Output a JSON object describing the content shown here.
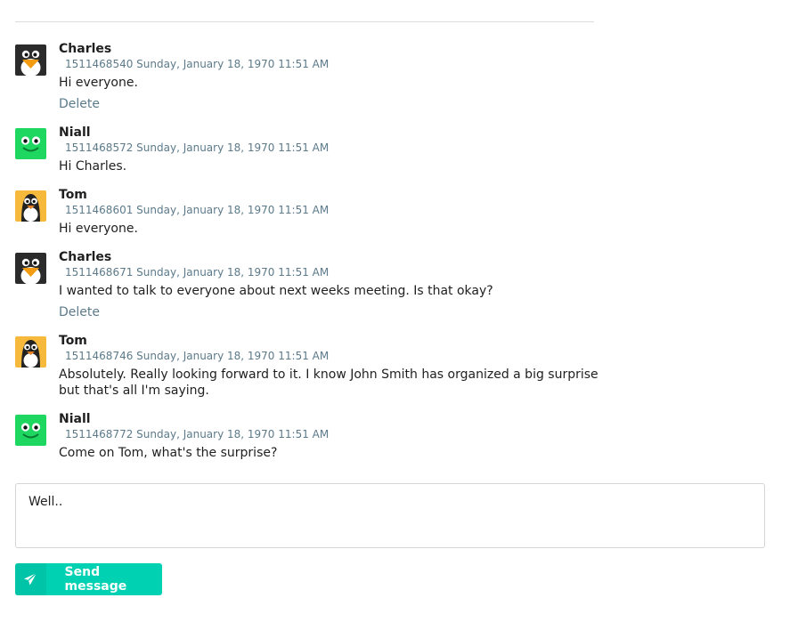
{
  "messages": [
    {
      "author": "Charles",
      "meta": "1511468540 Sunday, January 18, 1970 11:51 AM",
      "text": "Hi everyone.",
      "delete": "Delete",
      "avatar": "penguin-black-icon"
    },
    {
      "author": "Niall",
      "meta": "1511468572 Sunday, January 18, 1970 11:51 AM",
      "text": "Hi Charles.",
      "avatar": "green-smiley-icon"
    },
    {
      "author": "Tom",
      "meta": "1511468601 Sunday, January 18, 1970 11:51 AM",
      "text": "Hi everyone.",
      "avatar": "penguin-yellow-icon"
    },
    {
      "author": "Charles",
      "meta": "1511468671 Sunday, January 18, 1970 11:51 AM",
      "text": "I wanted to talk to everyone about next weeks meeting. Is that okay?",
      "delete": "Delete",
      "avatar": "penguin-black-icon"
    },
    {
      "author": "Tom",
      "meta": "1511468746 Sunday, January 18, 1970 11:51 AM",
      "text": "Absolutely. Really looking forward to it. I know John Smith has organized a big surprise but that's all I'm saying.",
      "avatar": "penguin-yellow-icon"
    },
    {
      "author": "Niall",
      "meta": "1511468772 Sunday, January 18, 1970 11:51 AM",
      "text": "Come on Tom, what's the surprise?",
      "avatar": "green-smiley-icon"
    }
  ],
  "composer": {
    "value": "Well.."
  },
  "send_button": {
    "label": "Send message",
    "icon": "paper-plane-icon"
  },
  "colors": {
    "accent": "#00d1b2",
    "meta": "#5c7a8a"
  }
}
